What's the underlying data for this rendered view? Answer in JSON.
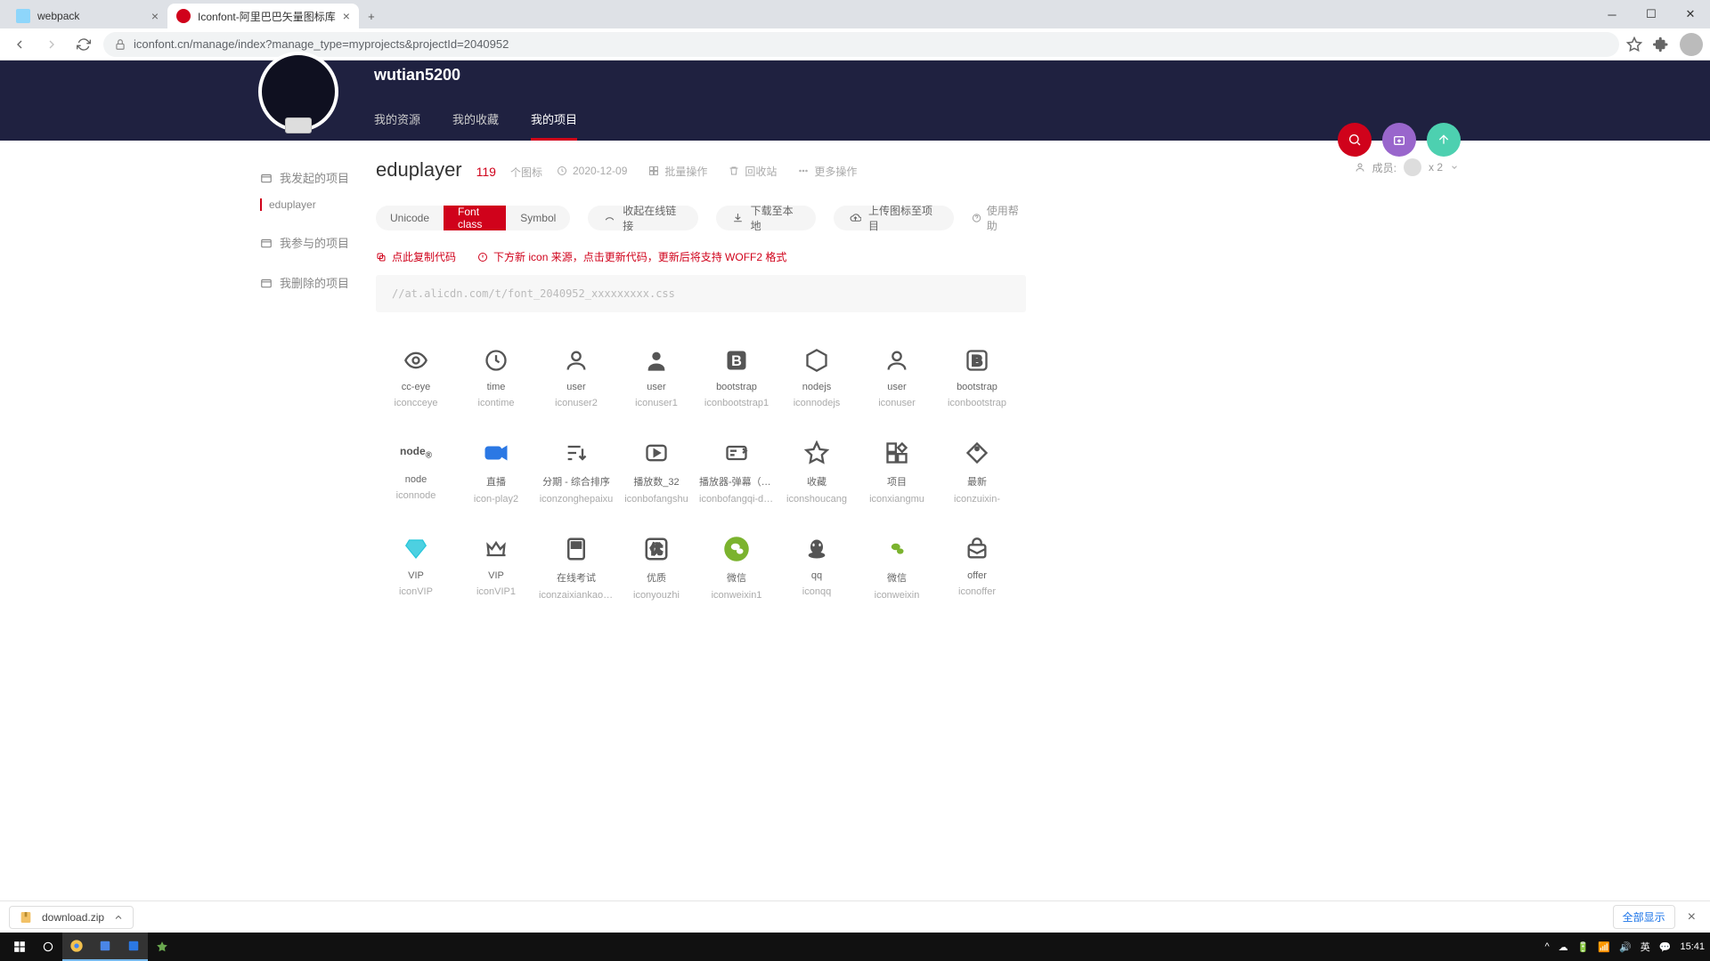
{
  "browser": {
    "tabs": [
      {
        "title": "webpack",
        "active": false,
        "favicon": "#8ed6fb"
      },
      {
        "title": "Iconfont-阿里巴巴矢量图标库",
        "active": true,
        "favicon": "#d0021b"
      }
    ],
    "url": "iconfont.cn/manage/index?manage_type=myprojects&projectId=2040952"
  },
  "header": {
    "username": "wutian5200",
    "tabs": [
      {
        "label": "我的资源",
        "active": false
      },
      {
        "label": "我的收藏",
        "active": false
      },
      {
        "label": "我的项目",
        "active": true
      }
    ]
  },
  "sidebar": {
    "s1": "我发起的项目",
    "subitem": "eduplayer",
    "s2": "我参与的项目",
    "s3": "我删除的项目"
  },
  "project": {
    "name": "eduplayer",
    "count": "119",
    "count_label": "个图标",
    "date": "2020-12-09",
    "batch": "批量操作",
    "trash": "回收站",
    "more": "更多操作",
    "members_label": "成员:",
    "members_count": "x 2"
  },
  "modes": {
    "unicode": "Unicode",
    "fontclass": "Font class",
    "symbol": "Symbol"
  },
  "pills": {
    "collapse": "收起在线链接",
    "download": "下载至本地",
    "upload": "上传图标至项目"
  },
  "help": "使用帮助",
  "warn": {
    "copy": "点此复制代码",
    "notice": "下方新 icon 来源，点击更新代码，更新后将支持 WOFF2 格式"
  },
  "codeurl": "//at.alicdn.com/t/font_2040952_xxxxxxxxx.css",
  "icons": [
    {
      "n": "cc-eye",
      "c": "iconcceye",
      "g": "eye"
    },
    {
      "n": "time",
      "c": "icontime",
      "g": "clock"
    },
    {
      "n": "user",
      "c": "iconuser2",
      "g": "userO"
    },
    {
      "n": "user",
      "c": "iconuser1",
      "g": "userF"
    },
    {
      "n": "bootstrap",
      "c": "iconbootstrap1",
      "g": "bsF"
    },
    {
      "n": "nodejs",
      "c": "iconnodejs",
      "g": "node"
    },
    {
      "n": "user",
      "c": "iconuser",
      "g": "userO"
    },
    {
      "n": "bootstrap",
      "c": "iconbootstrap",
      "g": "bsO"
    },
    {
      "n": "node",
      "c": "iconnode",
      "g": "nodeT"
    },
    {
      "n": "直播",
      "c": "icon-play2",
      "g": "cam"
    },
    {
      "n": "分期 - 综合排序",
      "c": "iconzonghepaixu",
      "g": "sort"
    },
    {
      "n": "播放数_32",
      "c": "iconbofangshu",
      "g": "play"
    },
    {
      "n": "播放器-弹幕（开...",
      "c": "iconbofangqi-da...",
      "g": "danmu"
    },
    {
      "n": "收藏",
      "c": "iconshoucang",
      "g": "star"
    },
    {
      "n": "项目",
      "c": "iconxiangmu",
      "g": "grid"
    },
    {
      "n": "最新",
      "c": "iconzuixin-",
      "g": "tag"
    },
    {
      "n": "VIP",
      "c": "iconVIP",
      "g": "diamond"
    },
    {
      "n": "VIP",
      "c": "iconVIP1",
      "g": "crown"
    },
    {
      "n": "在线考试",
      "c": "iconzaixiankaoshi",
      "g": "test"
    },
    {
      "n": "优质",
      "c": "iconyouzhi",
      "g": "you"
    },
    {
      "n": "微信",
      "c": "iconweixin1",
      "g": "wechatF"
    },
    {
      "n": "qq",
      "c": "iconqq",
      "g": "qq"
    },
    {
      "n": "微信",
      "c": "iconweixin",
      "g": "wechatO"
    },
    {
      "n": "offer",
      "c": "iconoffer",
      "g": "offer"
    }
  ],
  "download": {
    "file": "download.zip",
    "showall": "全部显示"
  },
  "taskbar": {
    "time": "15:41",
    "ime": "英"
  }
}
